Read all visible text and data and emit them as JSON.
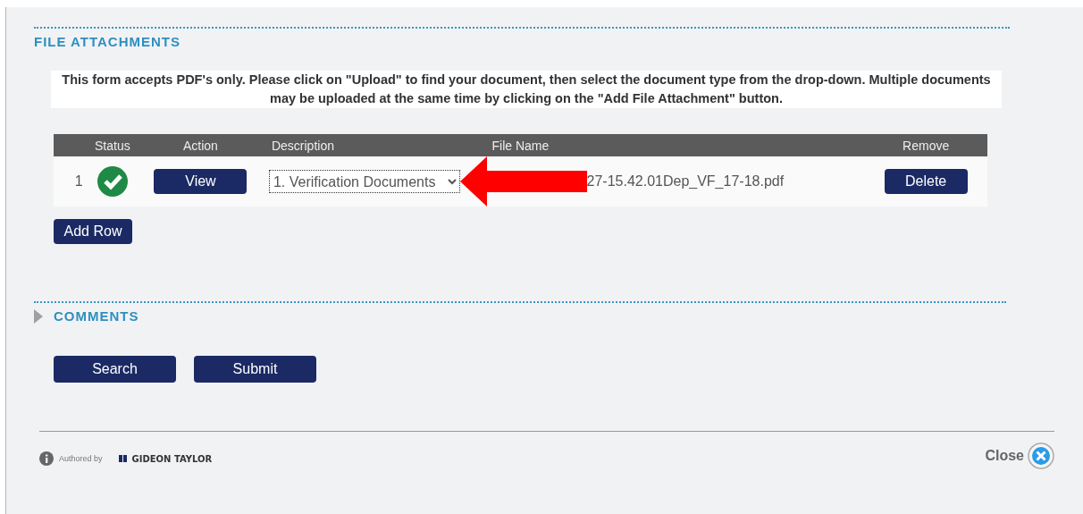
{
  "attachments": {
    "title": "FILE ATTACHMENTS",
    "instructions": "This form accepts PDF's only.  Please click on \"Upload\" to find your document, then select the document type from the drop-down.  Multiple documents may be uploaded at the same time by clicking on the \"Add File Attachment\" button.",
    "table": {
      "columns": [
        "Status",
        "Action",
        "Description",
        "File Name",
        "Remove"
      ],
      "rows": [
        {
          "number": "1",
          "complete": true,
          "action": "View",
          "description": "1. Verification Documents",
          "file_name": "27-15.42.01Dep_VF_17-18.pdf",
          "remove": "Delete",
          "annotated": true
        }
      ]
    },
    "add_button": "Add Row"
  },
  "comments": {
    "title": "COMMENTS",
    "expanded": false
  },
  "buttons": [
    "Search",
    "Submit"
  ],
  "footer": {
    "authored_by": "Authored by",
    "brand": "GIDEON TAYLOR",
    "close": "Close"
  }
}
